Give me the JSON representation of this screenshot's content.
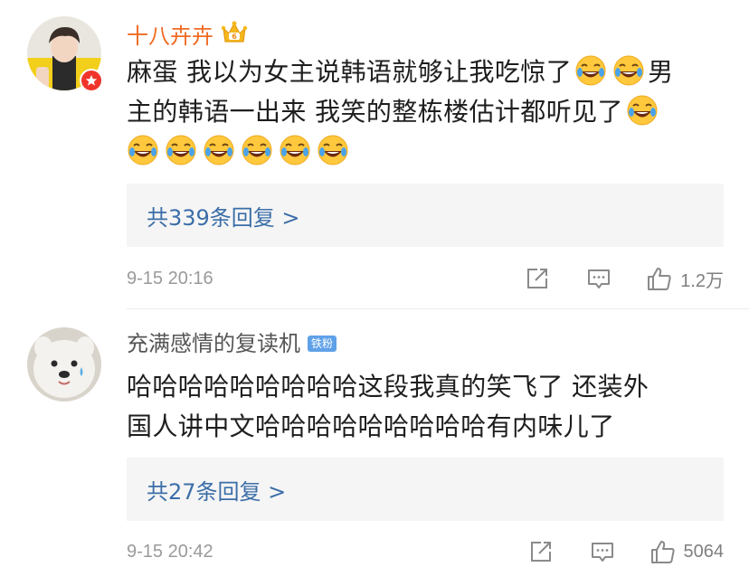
{
  "comments": [
    {
      "username": "十八卉卉",
      "text_line1": "麻蛋 我以为女主说韩语就够让我吃惊了",
      "text_line1b": "男",
      "text_line2": "主的韩语一出来 我笑的整栋楼估计都听见了",
      "replies_label": "共339条回复 >",
      "time": "9-15 20:16",
      "likes": "1.2万"
    },
    {
      "username": "充满感情的复读机",
      "badge": "铁粉",
      "text_line1": "哈哈哈哈哈哈哈哈哈这段我真的笑飞了 还装外",
      "text_line2": "国人讲中文哈哈哈哈哈哈哈哈哈有内味儿了",
      "replies_label": "共27条回复 >",
      "time": "9-15 20:42",
      "likes": "5064"
    }
  ],
  "colors": {
    "vip_name": "#f06a22",
    "reply_link": "#3b6ea8",
    "fan_badge": "#5fa1e8"
  },
  "icons": [
    "crown-vip-icon",
    "verified-badge-icon",
    "laughing-tears-emoji",
    "share-icon",
    "comment-icon",
    "like-icon"
  ]
}
